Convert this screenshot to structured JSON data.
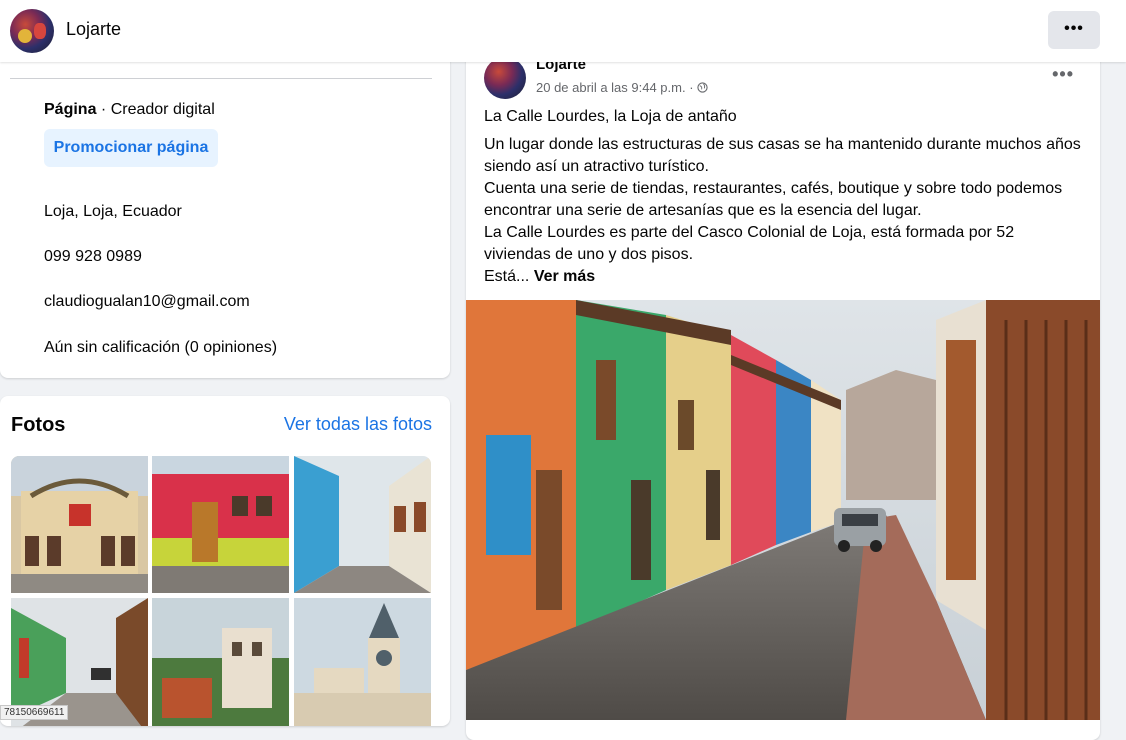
{
  "header": {
    "page_name": "Lojarte",
    "more_icon": "ellipsis-icon"
  },
  "intro": {
    "page_type_label": "Página",
    "page_type_value": " · Creador digital",
    "promote_button": "Promocionar página",
    "location": "Loja, Loja, Ecuador",
    "phone": "099 928 0989",
    "email": "claudiogualan10@gmail.com",
    "rating": "Aún sin calificación (0 opiniones)"
  },
  "photos": {
    "title": "Fotos",
    "see_all_link": "Ver todas las fotos"
  },
  "status_url": "78150669611",
  "post": {
    "author": "Lojarte",
    "timestamp": "20 de abril a las 9:44 p.m. · ",
    "title_line": "La Calle Lourdes, la Loja de antaño",
    "paragraph1": "Un lugar donde las estructuras de sus casas se ha mantenido durante muchos años siendo así un atractivo turístico.",
    "paragraph2": "Cuenta una serie de tiendas, restaurantes, cafés, boutique y sobre todo podemos encontrar una serie de artesanías que es la esencia del lugar.",
    "paragraph3": "La Calle Lourdes es parte del Casco Colonial de Loja, está formada por 52 viviendas de uno y dos pisos.",
    "truncated": "Está...",
    "see_more": "Ver más",
    "more_icon": "ellipsis-icon",
    "audience_icon": "globe-icon"
  }
}
